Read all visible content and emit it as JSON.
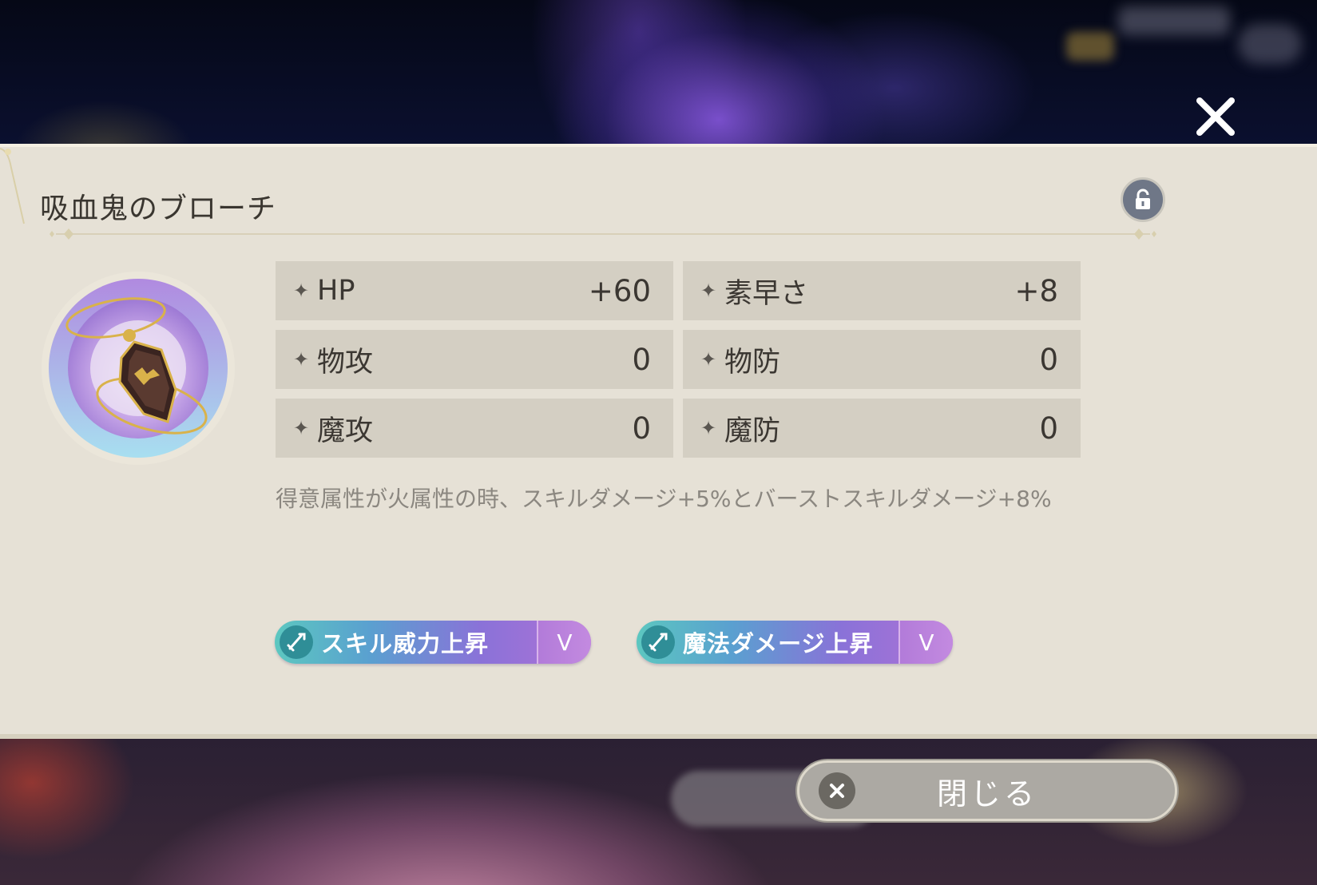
{
  "item": {
    "name": "吸血鬼のブローチ",
    "icon": "vampire-coffin-brooch-icon"
  },
  "stats": {
    "left": [
      {
        "label": "HP",
        "value": "+60"
      },
      {
        "label": "物攻",
        "value": "0"
      },
      {
        "label": "魔攻",
        "value": "0"
      }
    ],
    "right": [
      {
        "label": "素早さ",
        "value": "+8"
      },
      {
        "label": "物防",
        "value": "0"
      },
      {
        "label": "魔防",
        "value": "0"
      }
    ],
    "star_glyph": "✦"
  },
  "description": "得意属性が火属性の時、スキルダメージ+5%とバーストスキルダメージ+8%",
  "skills": [
    {
      "label": "スキル威力上昇",
      "rank": "V"
    },
    {
      "label": "魔法ダメージ上昇",
      "rank": "V"
    }
  ],
  "buttons": {
    "close_label": "閉じる"
  },
  "colors": {
    "panel_bg": "#e6e1d6",
    "stat_bg": "#d4cfc3",
    "skill_gradient_start": "#5cc7c0",
    "skill_gradient_end": "#b071d6",
    "lock_button": "#6f7787",
    "close_button": "#aca9a3"
  }
}
